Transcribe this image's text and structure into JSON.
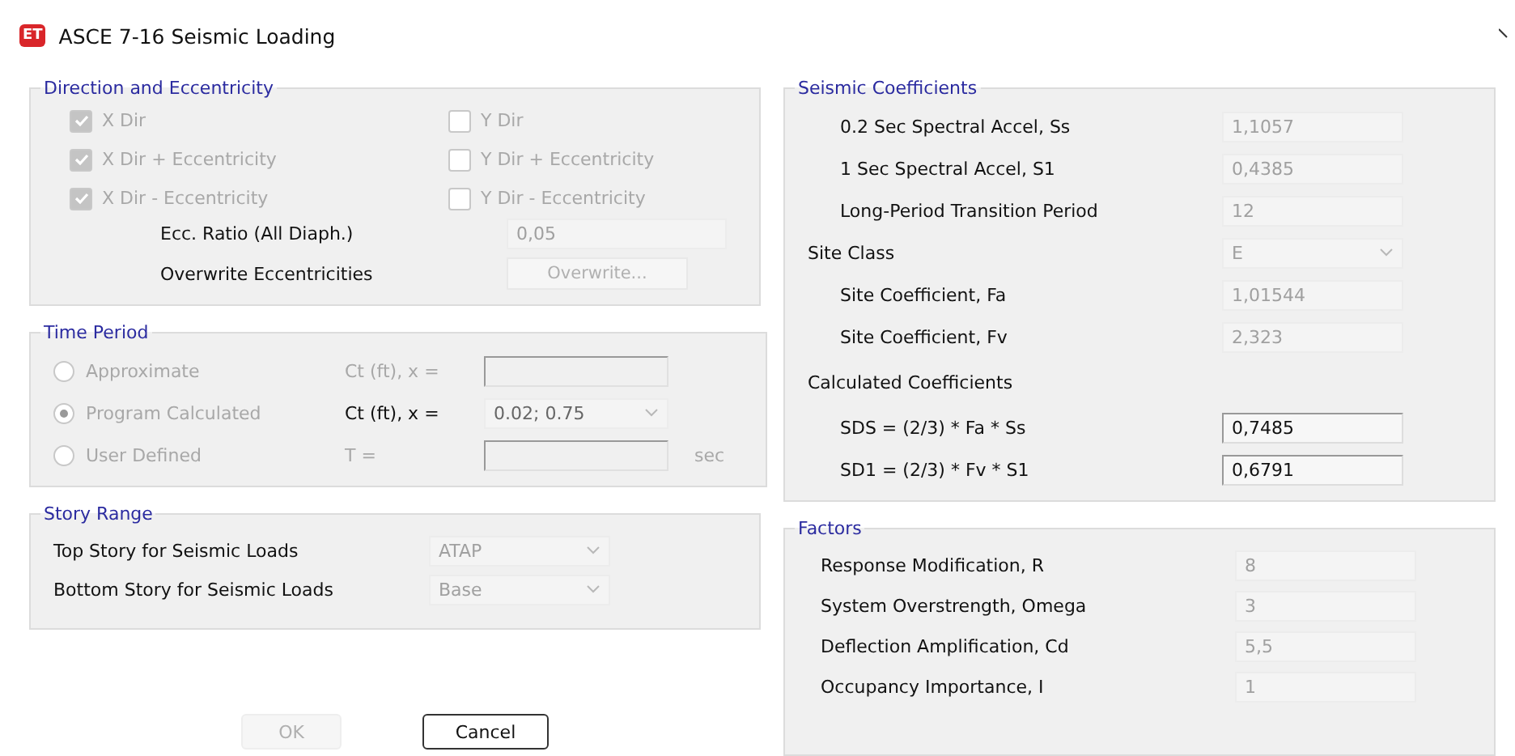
{
  "window": {
    "title": "ASCE 7-16 Seismic Loading",
    "logo": "ET"
  },
  "direction": {
    "title": "Direction and Eccentricity",
    "checks": [
      {
        "label": "X Dir",
        "checked": true,
        "disabled": true
      },
      {
        "label": "Y Dir",
        "checked": false,
        "disabled": true
      },
      {
        "label": "X Dir + Eccentricity",
        "checked": true,
        "disabled": true
      },
      {
        "label": "Y Dir + Eccentricity",
        "checked": false,
        "disabled": true
      },
      {
        "label": "X Dir - Eccentricity",
        "checked": true,
        "disabled": true
      },
      {
        "label": "Y Dir - Eccentricity",
        "checked": false,
        "disabled": true
      }
    ],
    "ecc_ratio": {
      "label": "Ecc. Ratio (All Diaph.)",
      "value": "0,05",
      "disabled": true
    },
    "overwrite": {
      "label": "Overwrite Eccentricities",
      "button": "Overwrite...",
      "disabled": true
    }
  },
  "time_period": {
    "title": "Time Period",
    "options": [
      {
        "label": "Approximate",
        "selected": false,
        "disabled": true,
        "param": "Ct (ft), x =",
        "param_disabled": true,
        "kind": "text"
      },
      {
        "label": "Program Calculated",
        "selected": true,
        "disabled": true,
        "param": "Ct (ft), x =",
        "param_disabled": false,
        "kind": "select",
        "value": "0.02;  0.75"
      },
      {
        "label": "User Defined",
        "selected": false,
        "disabled": true,
        "param": "T =",
        "param_disabled": true,
        "kind": "text",
        "unit": "sec"
      }
    ]
  },
  "story_range": {
    "title": "Story Range",
    "rows": [
      {
        "label": "Top Story for Seismic Loads",
        "value": "ATAP",
        "disabled": true
      },
      {
        "label": "Bottom Story for Seismic Loads",
        "value": "Base",
        "disabled": true
      }
    ]
  },
  "buttons": [
    {
      "label": "OK",
      "disabled": true
    },
    {
      "label": "Cancel",
      "disabled": false
    }
  ],
  "seismic": {
    "title": "Seismic Coefficients",
    "rows": [
      {
        "kind": "field",
        "label": "0.2 Sec Spectral Accel, Ss",
        "value": "1,1057",
        "disabled": true
      },
      {
        "kind": "field",
        "label": "1 Sec Spectral Accel, S1",
        "value": "0,4385",
        "disabled": true
      },
      {
        "kind": "field",
        "label": "Long-Period Transition Period",
        "value": "12",
        "disabled": true
      },
      {
        "kind": "select",
        "label": "Site Class",
        "value": "E",
        "disabled": true
      },
      {
        "kind": "field",
        "label": "Site Coefficient, Fa",
        "value": "1,01544",
        "disabled": true
      },
      {
        "kind": "field",
        "label": "Site Coefficient, Fv",
        "value": "2,323",
        "disabled": true
      },
      {
        "kind": "heading",
        "label": "Calculated Coefficients"
      },
      {
        "kind": "field",
        "label": "SDS = (2/3) * Fa * Ss",
        "value": "0,7485",
        "disabled": false
      },
      {
        "kind": "field",
        "label": "SD1 = (2/3) * Fv * S1",
        "value": "0,6791",
        "disabled": false
      }
    ]
  },
  "factors": {
    "title": "Factors",
    "rows": [
      {
        "label": "Response Modification, R",
        "value": "8",
        "disabled": true
      },
      {
        "label": "System Overstrength, Omega",
        "value": "3",
        "disabled": true
      },
      {
        "label": "Deflection Amplification, Cd",
        "value": "5,5",
        "disabled": true
      },
      {
        "label": "Occupancy Importance, I",
        "value": "1",
        "disabled": true
      }
    ]
  }
}
